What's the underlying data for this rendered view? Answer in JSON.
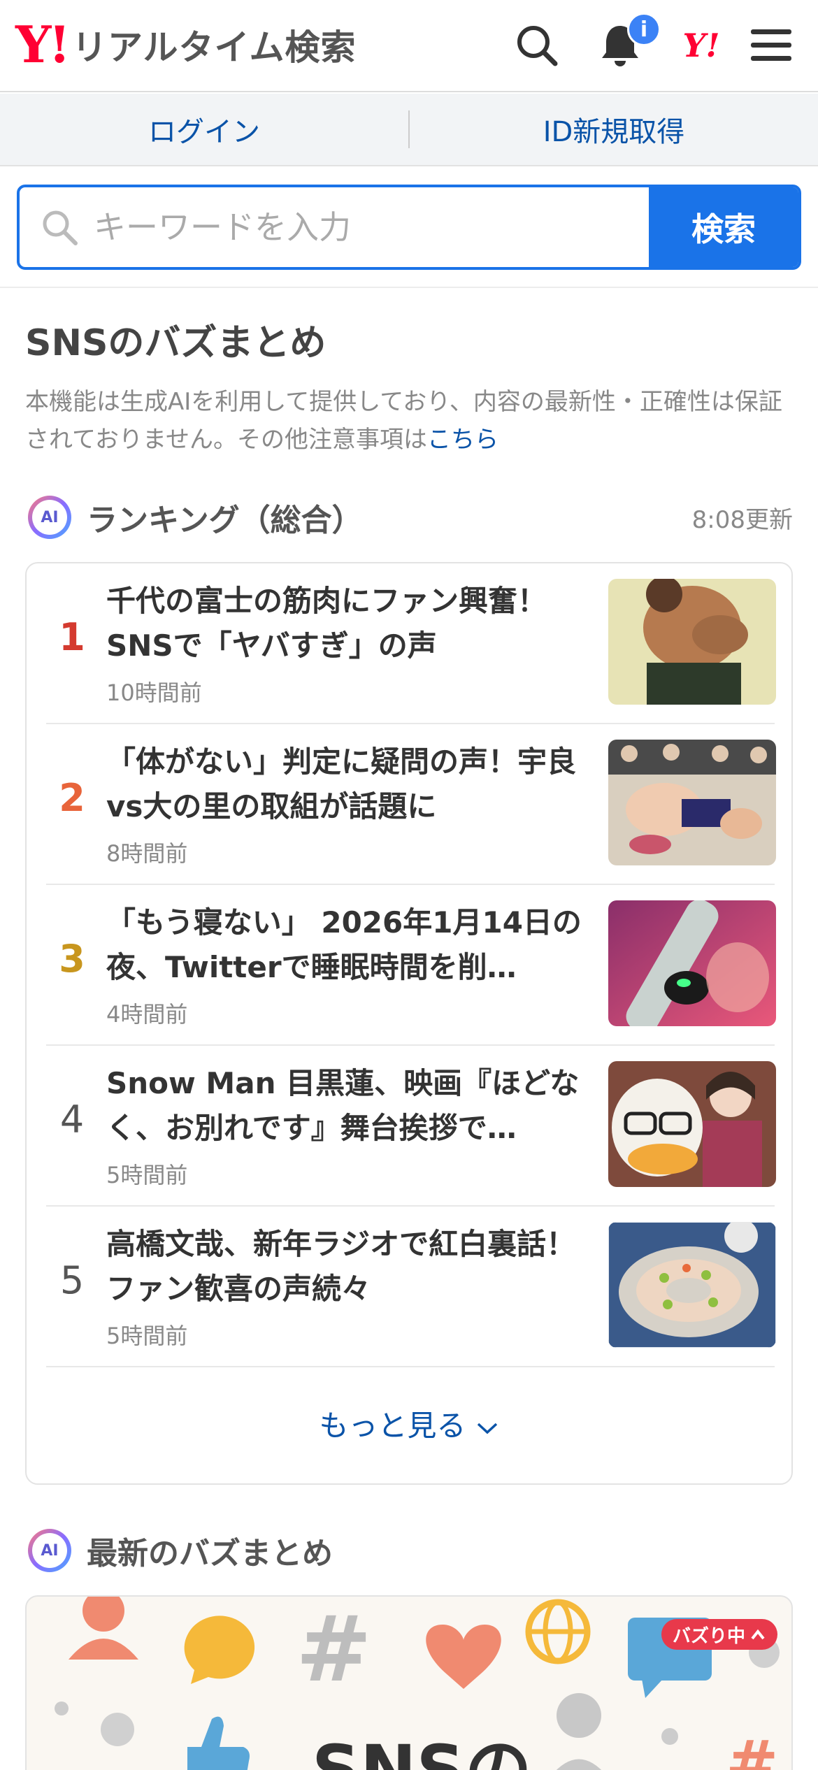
{
  "header": {
    "logo_mark": "Y!",
    "logo_text": "リアルタイム検索",
    "notification_badge": "i",
    "yj_mark": "Y!"
  },
  "account": {
    "login_label": "ログイン",
    "register_label": "ID新規取得"
  },
  "search": {
    "placeholder": "キーワードを入力",
    "button_label": "検索"
  },
  "section": {
    "title": "SNSのバズまとめ",
    "disclaimer": "本機能は生成AIを利用して提供しており、内容の最新性・正確性は保証されておりません。その他注意事項は",
    "disclaimer_link": "こちら"
  },
  "ranking": {
    "ai_label": "AI",
    "title": "ランキング（総合）",
    "updated": "8:08更新",
    "items": [
      {
        "rank": "1",
        "headline": "千代の富士の筋肉にファン興奮！SNSで「ヤバすぎ」の声",
        "time": "10時間前",
        "rank_color": "#d43a2f"
      },
      {
        "rank": "2",
        "headline": "「体がない」判定に疑問の声！宇良vs大の里の取組が話題に",
        "time": "8時間前",
        "rank_color": "#e8643a"
      },
      {
        "rank": "3",
        "headline": "「もう寝ない」 2026年1月14日の夜、Twitterで睡眠時間を削…",
        "time": "4時間前",
        "rank_color": "#c8961e"
      },
      {
        "rank": "4",
        "headline": "Snow Man 目黒蓮、映画『ほどなく、お別れです』舞台挨拶で…",
        "time": "5時間前",
        "rank_color": "#555555"
      },
      {
        "rank": "5",
        "headline": "高橋文哉、新年ラジオで紅白裏話！ファン歓喜の声続々",
        "time": "5時間前",
        "rank_color": "#555555"
      }
    ],
    "more_label": "もっと見る"
  },
  "latest": {
    "ai_label": "AI",
    "title": "最新のバズまとめ",
    "badge": "バズり中",
    "banner_text": "SNSの"
  }
}
